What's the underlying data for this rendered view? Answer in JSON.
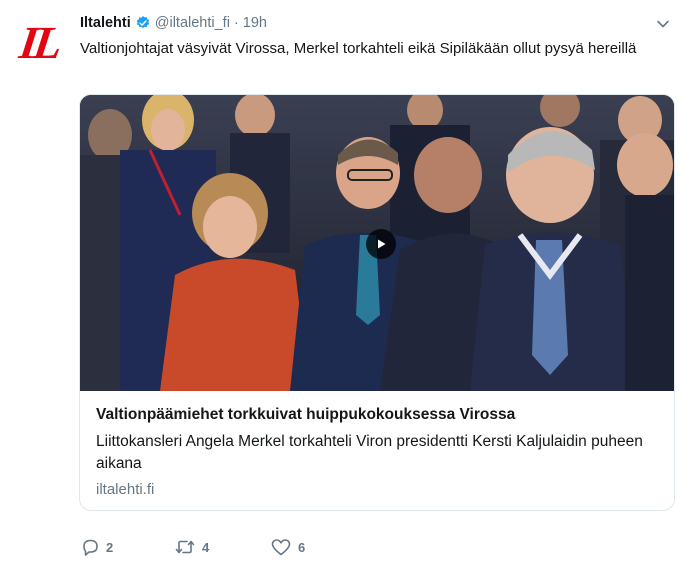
{
  "account": {
    "logo_text": "IL",
    "name": "Iltalehti",
    "handle": "@iltalehti_fi",
    "separator": "·",
    "time": "19h"
  },
  "tweet": {
    "text": "Valtionjohtajat väsyivät Virossa, Merkel torkahteli eikä Sipiläkään ollut pysyä hereillä"
  },
  "card": {
    "title": "Valtionpäämiehet torkkuivat huippukokouksessa Virossa",
    "description": "Liittokansleri Angela Merkel torkahteli Viron presidentti Kersti Kaljulaidin puheen aikana",
    "domain": "iltalehti.fi"
  },
  "actions": {
    "reply_count": "2",
    "retweet_count": "4",
    "like_count": "6"
  },
  "colors": {
    "brand_red": "#e30613",
    "verified_blue": "#1da1f2",
    "secondary_text": "#657786",
    "border": "#e1e8ed"
  },
  "icons": [
    "verified-icon",
    "chevron-down-icon",
    "play-icon",
    "reply-icon",
    "retweet-icon",
    "like-icon"
  ]
}
